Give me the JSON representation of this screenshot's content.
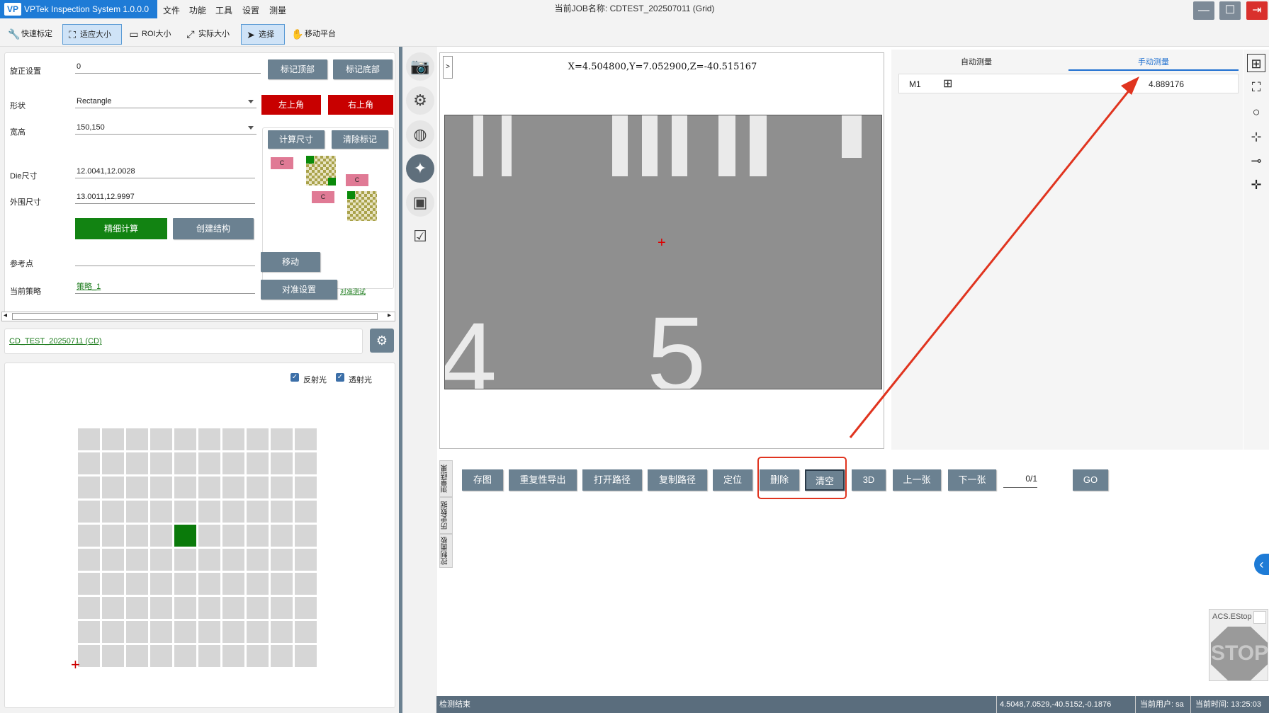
{
  "app": {
    "logo_text": "VP",
    "title": "VPTek Inspection System 1.0.0.0",
    "job_title": "当前JOB名称: CDTEST_202507011 (Grid)"
  },
  "menu": [
    "文件",
    "功能",
    "工具",
    "设置",
    "测量"
  ],
  "window_controls": {
    "minimize": "—",
    "maximize": "☐",
    "exit": "⇥"
  },
  "toolbar": {
    "quick_calib": "快速标定",
    "fit_size": "适应大小",
    "roi_size": "ROI大小",
    "actual_size": "实际大小",
    "select": "选择",
    "move_stage": "移动平台"
  },
  "settings": {
    "rotation_label": "旋正设置",
    "rotation_value": "0",
    "mark_top": "标记顶部",
    "mark_bottom": "标记底部",
    "shape_label": "形状",
    "shape_value": "Rectangle",
    "top_left": "左上角",
    "top_right": "右上角",
    "wh_label": "宽高",
    "wh_value": "150,150",
    "calc_size": "计算尺寸",
    "clear_mark": "清除标记",
    "die_label": "Die尺寸",
    "die_value": "12.0041,12.0028",
    "outer_label": "外围尺寸",
    "outer_value": "13.0011,12.9997",
    "fine_calc": "精细计算",
    "create_struct": "创建结构",
    "ref_label": "参考点",
    "ref_value": "",
    "move": "移动",
    "strategy_label": "当前策略",
    "strategy_value": "策略_1",
    "align_settings": "对准设置",
    "align_test": "对准测试",
    "diagram_c": "C"
  },
  "job_link": "CD_TEST_20250711 (CD)",
  "scroll": {
    "left": "◂",
    "right": "▸"
  },
  "light": {
    "reflect": "反射光",
    "transmit": "透射光",
    "reflect_checked": true,
    "transmit_checked": true
  },
  "wafer_map": {
    "rows": 10,
    "cols": 10,
    "selected_row": 4,
    "selected_col": 4,
    "origin_marker": "+"
  },
  "camera": {
    "toggle": ">",
    "coords": "X=4.504800,Y=7.052900,Z=-40.515167",
    "digits": [
      "4",
      "5"
    ],
    "crosshair": "+"
  },
  "side_icons": [
    "camera-icon",
    "grid-settings-icon",
    "sphere-grid-icon",
    "satellite-icon",
    "image-frame-icon",
    "checklist-icon"
  ],
  "measure": {
    "tab_auto": "自动测量",
    "tab_manual": "手动测量",
    "rows": [
      {
        "name": "M1",
        "value": "4.889176"
      }
    ]
  },
  "right_tools": [
    "measure-tool-icon",
    "fit-frame-icon",
    "circle-tool-icon",
    "center-target-icon",
    "line-point-icon",
    "crosshair-move-icon"
  ],
  "result_tabs": [
    "测量结果",
    "历史数据",
    "控制面板"
  ],
  "bottom_buttons": {
    "save_img": "存图",
    "repeat_export": "重复性导出",
    "open_path": "打开路径",
    "copy_path": "复制路径",
    "locate": "定位",
    "delete": "删除",
    "clear": "清空",
    "threed": "3D",
    "prev": "上一张",
    "next": "下一张",
    "page": "0/1",
    "go": "GO"
  },
  "collapse_arrow": "‹",
  "estop": {
    "label": "ACS.EStop",
    "stop": "STOP"
  },
  "status": {
    "message": "检测结束",
    "coords": "4.5048,7.0529,-40.5152,-0.1876",
    "user": "当前用户: sa",
    "time": "当前时间: 13:25:03"
  },
  "colors": {
    "accent": "#1e7bd6",
    "button": "#6b8191",
    "danger": "#c80000",
    "success": "#128312",
    "annotation": "#e0341f"
  }
}
